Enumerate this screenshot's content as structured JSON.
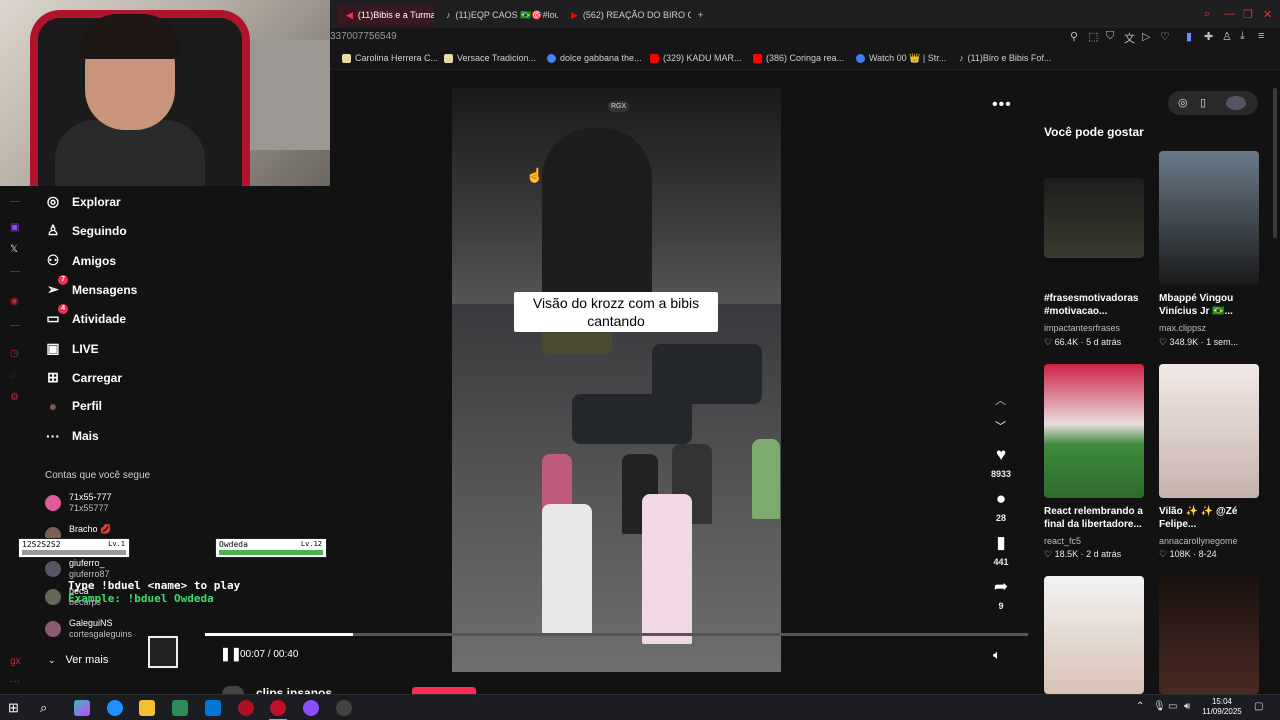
{
  "browser": {
    "tabs": [
      {
        "label": "(11)Bibis e a Turma da...",
        "active": true
      },
      {
        "label": "(11)EQP CAOS 🇧🇷🎯#loud..."
      },
      {
        "label": "(562) REAÇÃO DO BIRO C..."
      }
    ],
    "new_tab": "+",
    "address": "337007756549",
    "bookmarks": [
      {
        "label": "Carolina Herrera C...",
        "color": "#e8d9a8"
      },
      {
        "label": "Versace Tradicion...",
        "color": "#e8d9a8"
      },
      {
        "label": "dolce gabbana the...",
        "color": "#4285f4"
      },
      {
        "label": "(329) KADU MAR...",
        "color": "#ff0000"
      },
      {
        "label": "(386) Coringa rea...",
        "color": "#ff0000"
      },
      {
        "label": "Watch 00 👑 | Str...",
        "color": "#3b82f6"
      },
      {
        "label": "(11)Biro e Bibis Fof...",
        "color": "#ffffff"
      }
    ]
  },
  "sidebar": {
    "items": [
      {
        "label": "Explorar",
        "icon": "compass-icon",
        "glyph": "◎"
      },
      {
        "label": "Seguindo",
        "icon": "user-follow-icon",
        "glyph": "♙"
      },
      {
        "label": "Amigos",
        "icon": "friends-icon",
        "glyph": "⚇"
      },
      {
        "label": "Mensagens",
        "icon": "send-icon",
        "glyph": "➢",
        "badge": "7"
      },
      {
        "label": "Atividade",
        "icon": "inbox-icon",
        "glyph": "▭",
        "badge": "4"
      },
      {
        "label": "LIVE",
        "icon": "live-tv-icon",
        "glyph": "▣"
      },
      {
        "label": "Carregar",
        "icon": "upload-icon",
        "glyph": "⊞"
      },
      {
        "label": "Perfil",
        "icon": "profile-avatar",
        "glyph": "●"
      },
      {
        "label": "Mais",
        "icon": "more-icon",
        "glyph": "···"
      }
    ],
    "following_title": "Contas que você segue",
    "accounts": [
      {
        "name": "71x55-777",
        "handle": "71x55777"
      },
      {
        "name": "Bracho 💋",
        "handle": "..."
      },
      {
        "name": "giuferro_",
        "handle": "giuferro87"
      },
      {
        "name": "beca",
        "handle": "becarps"
      },
      {
        "name": "GaleguiNS",
        "handle": "cortesgaleguins"
      }
    ],
    "see_more": "Ver mais"
  },
  "video": {
    "badge": "RGX",
    "caption": "Visão do krozz com a bibis cantando",
    "likes": "8933",
    "comments": "28",
    "saves": "441",
    "shares": "9",
    "time": "00:07 / 00:40",
    "progress": 0.18,
    "title": "clips insanos"
  },
  "game_overlay": {
    "player1": {
      "name": "12S2S2S2",
      "level": "Lv.1"
    },
    "player2": {
      "name": "Owdeda",
      "level": "Lv.12"
    },
    "line1": "Type !bduel <name> to play",
    "line2": "Example: !bduel Owdeda"
  },
  "suggestions": {
    "title": "Você pode gostar",
    "cards": [
      {
        "title": "#frasesmotivadoras #motivacao...",
        "user": "impactantesrfrases",
        "likes": "66.4K",
        "date": "5 d atrás"
      },
      {
        "title": "Mbappé Vingou Vinícius Jr 🇧🇷...",
        "user": "max.clippsz",
        "likes": "348.9K",
        "date": "1 sem..."
      },
      {
        "title": "React relembrando a final da libertadore...",
        "user": "react_fc5",
        "likes": "18.5K",
        "date": "2 d atrás"
      },
      {
        "title": "Vilão ✨ ✨ @Zé Felipe...",
        "user": "annacarollynegome",
        "likes": "108K",
        "date": "8-24"
      }
    ]
  },
  "taskbar": {
    "time": "15:04",
    "date": "11/09/2025"
  }
}
